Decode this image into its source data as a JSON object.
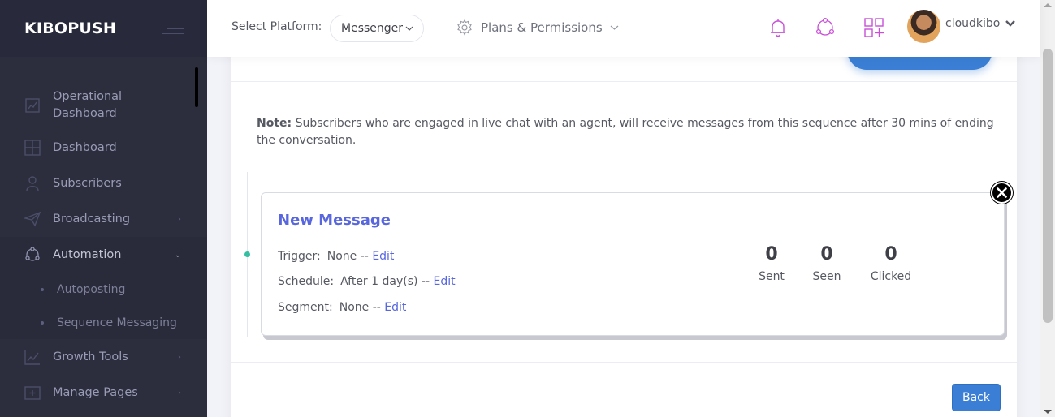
{
  "brand": {
    "logo_text": "KIBOPUSH"
  },
  "sidebar": {
    "items": [
      {
        "label": "Operational Dashboard",
        "icon": "chart-icon"
      },
      {
        "label": "Dashboard",
        "icon": "dashboard-grid-icon"
      },
      {
        "label": "Subscribers",
        "icon": "users-icon"
      },
      {
        "label": "Broadcasting",
        "icon": "paper-plane-icon",
        "has_arrow": true
      },
      {
        "label": "Automation",
        "icon": "automation-icon",
        "expanded": true
      },
      {
        "label": "Growth Tools",
        "icon": "growth-chart-icon",
        "has_arrow": true
      },
      {
        "label": "Manage Pages",
        "icon": "manage-pages-icon",
        "has_arrow": true
      }
    ],
    "subitems": [
      {
        "label": "Autoposting"
      },
      {
        "label": "Sequence Messaging"
      }
    ]
  },
  "header": {
    "select_platform_label": "Select Platform:",
    "platform_value": "Messenger",
    "plans_label": "Plans & Permissions",
    "username": "cloudkibo"
  },
  "note": {
    "prefix": "Note:",
    "text": " Subscribers who are engaged in live chat with an agent, will receive messages from this sequence after 30 mins of ending the conversation."
  },
  "message_card": {
    "title": "New Message",
    "trigger_label": "Trigger:",
    "trigger_value": "None",
    "schedule_label": "Schedule:",
    "schedule_value": "After 1 day(s)",
    "segment_label": "Segment:",
    "segment_value": "None",
    "separator": "--",
    "edit_label": "Edit",
    "stats": [
      {
        "value": "0",
        "label": "Sent"
      },
      {
        "value": "0",
        "label": "Seen"
      },
      {
        "value": "0",
        "label": "Clicked"
      }
    ]
  },
  "footer": {
    "back_label": "Back"
  },
  "colors": {
    "sidebar_bg": "#2c2e3e",
    "accent": "#5867dd",
    "primary_button": "#3a7fd5",
    "icon_purple": "#c94fd8",
    "timeline_dot": "#34bfa3"
  }
}
